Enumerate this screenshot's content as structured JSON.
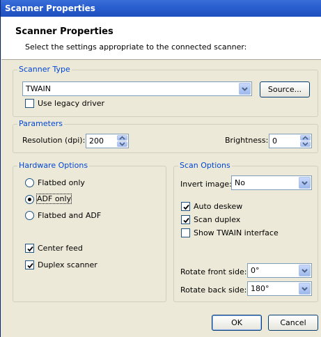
{
  "window": {
    "title": "Scanner Properties"
  },
  "header": {
    "title": "Scanner Properties",
    "subtitle": "Select the settings appropriate to the connected scanner:"
  },
  "scanner_type": {
    "legend": "Scanner Type",
    "combo_value": "TWAIN",
    "source_button": "Source...",
    "legacy_label": "Use legacy driver",
    "legacy_checked": false
  },
  "parameters": {
    "legend": "Parameters",
    "resolution_label": "Resolution (dpi):",
    "resolution_value": "200",
    "brightness_label": "Brightness:",
    "brightness_value": "0"
  },
  "hardware": {
    "legend": "Hardware Options",
    "radios": [
      {
        "label": "Flatbed only",
        "selected": false
      },
      {
        "label": "ADF only",
        "selected": true
      },
      {
        "label": "Flatbed and ADF",
        "selected": false
      }
    ],
    "center_feed_label": "Center feed",
    "center_feed_checked": true,
    "duplex_label": "Duplex scanner",
    "duplex_checked": true
  },
  "scan_options": {
    "legend": "Scan Options",
    "invert_label": "Invert image:",
    "invert_value": "No",
    "auto_deskew_label": "Auto deskew",
    "auto_deskew_checked": true,
    "scan_duplex_label": "Scan duplex",
    "scan_duplex_checked": true,
    "show_twain_label": "Show TWAIN interface",
    "show_twain_checked": false,
    "rotate_front_label": "Rotate front side:",
    "rotate_front_value": "0°",
    "rotate_back_label": "Rotate back side:",
    "rotate_back_value": "180°"
  },
  "footer": {
    "ok": "OK",
    "cancel": "Cancel"
  },
  "colors": {
    "titlebar": "#2a5fd0",
    "legend": "#0046d5",
    "dialog_bg": "#ece9d8"
  }
}
